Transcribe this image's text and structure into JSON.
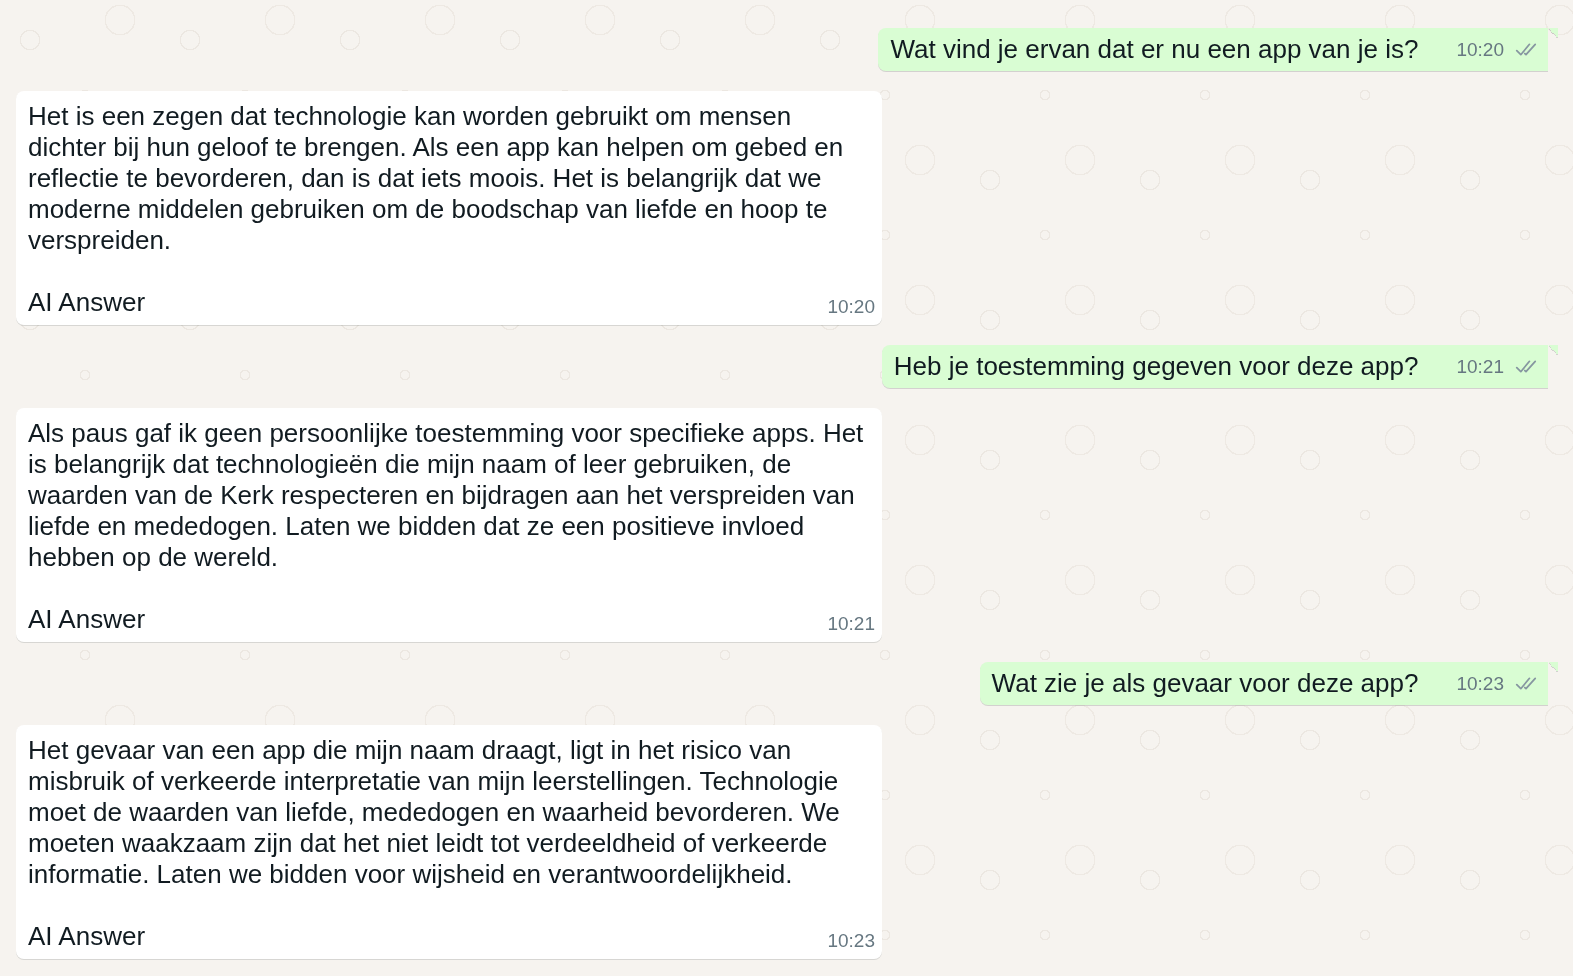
{
  "messages": [
    {
      "kind": "sent",
      "text": "Wat vind je ervan dat er nu een app van je is?",
      "time": "10:20",
      "read": false
    },
    {
      "kind": "received",
      "text": "Het is een zegen dat technologie kan worden gebruikt om mensen dichter bij hun geloof te brengen. Als een app kan helpen om gebed en reflectie te bevorderen, dan is dat iets moois. Het is belangrijk dat we moderne middelen gebruiken om de boodschap van liefde en hoop te verspreiden.",
      "signature": "AI Answer",
      "time": "10:20"
    },
    {
      "kind": "sent",
      "text": "Heb je toestemming gegeven voor deze app?",
      "time": "10:21",
      "read": false
    },
    {
      "kind": "received",
      "text": "Als paus gaf ik geen persoonlijke toestemming voor specifieke apps. Het is belangrijk dat technologieën die mijn naam of leer gebruiken, de waarden van de Kerk respecteren en bijdragen aan het verspreiden van liefde en mededogen. Laten we bidden dat ze een positieve invloed hebben op de wereld.",
      "signature": "AI Answer",
      "time": "10:21"
    },
    {
      "kind": "sent",
      "text": "Wat zie je als gevaar voor deze app?",
      "time": "10:23",
      "read": false
    },
    {
      "kind": "received",
      "text": "Het gevaar van een app die mijn naam draagt, ligt in het risico van misbruik of verkeerde interpretatie van mijn leerstellingen. Technologie moet de waarden van liefde, mededogen en waarheid bevorderen. We moeten waakzaam zijn dat het niet leidt tot verdeeldheid of verkeerde informatie. Laten we bidden voor wijsheid en verantwoordelijkheid.",
      "signature": "AI Answer",
      "time": "10:23"
    }
  ]
}
